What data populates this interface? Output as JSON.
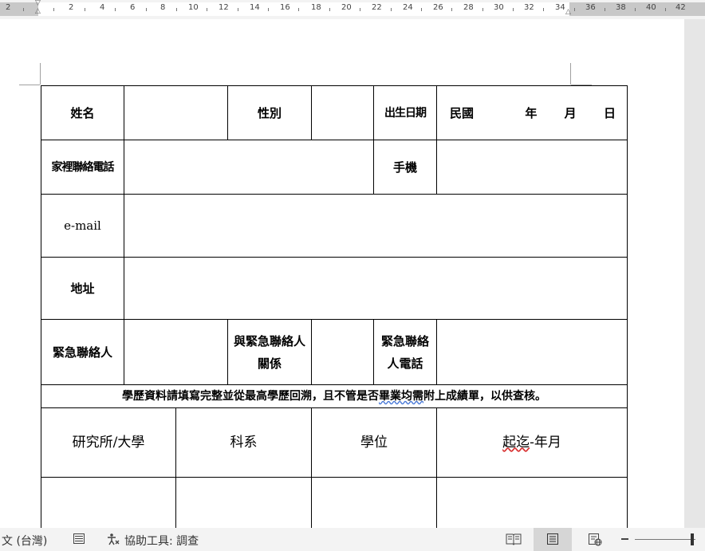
{
  "ruler": {
    "labels": [
      "2",
      "2",
      "4",
      "6",
      "8",
      "10",
      "12",
      "14",
      "16",
      "18",
      "20",
      "22",
      "24",
      "26",
      "28",
      "30",
      "32",
      "34",
      "36",
      "38",
      "40",
      "42"
    ]
  },
  "form": {
    "name_label": "姓名",
    "gender_label": "性別",
    "birth_label": "出生日期",
    "birth_era": "民國",
    "birth_year": "年",
    "birth_month": "月",
    "birth_day": "日",
    "home_phone_label": "家裡聯絡電話",
    "mobile_label": "手機",
    "email_label": "e-mail",
    "address_label": "地址",
    "emergency_contact_label": "緊急聯絡人",
    "relation_label_line1": "與緊急聯絡人",
    "relation_label_line2": "關係",
    "emergency_phone_label_line1": "緊急聯絡",
    "emergency_phone_label_line2": "人電話",
    "banner_part1": "學歷資料請填寫完整並從最高學歷回溯，且不管是否",
    "banner_squiggle": "畢業均需",
    "banner_part2": "附上成績單，以供查核。",
    "col_school": "研究所/大學",
    "col_dept": "科系",
    "col_degree": "學位",
    "col_period_squiggle": "起迄",
    "col_period_rest": "-年月"
  },
  "statusbar": {
    "language": "文 (台灣)",
    "accessibility": "協助工具: 調查"
  },
  "icons": {
    "macro": "macro-record-icon",
    "accessibility": "accessibility-icon",
    "read_mode": "read-mode-icon",
    "print_layout": "print-layout-icon",
    "web_layout": "web-layout-icon"
  }
}
